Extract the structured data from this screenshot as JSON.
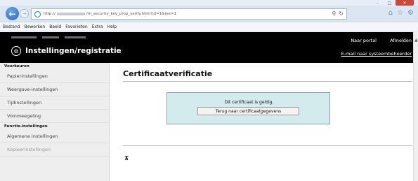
{
  "browser": {
    "address_prefix": "http://",
    "address_suffix": "/m_security_key_prop_verify.html?id=1&res=1",
    "icons": [
      "back-icon",
      "forward-icon",
      "search-icon",
      "refresh-icon",
      "home-icon",
      "star-icon",
      "gear-icon"
    ]
  },
  "menubar": {
    "items": [
      "Bestand",
      "Bewerken",
      "Beeld",
      "Favorieten",
      "Extra",
      "Help"
    ]
  },
  "header": {
    "title": "Instellingen/registratie",
    "portal_link": "Naar portal",
    "logout_link": "Afmelden",
    "mail_link": "E-mail naar systeembeheerder"
  },
  "sidebar": {
    "section1": "Voorkeuren",
    "items1": [
      "Papierinstellingen",
      "Weergave-instellingen",
      "Tijdinstellingen",
      "Voinmeegeling"
    ],
    "section2": "Functie-instellingen",
    "items2": [
      "Algemene instellingen",
      "Kopieerinstellingen"
    ]
  },
  "main": {
    "page_title": "Certificaatverificatie",
    "status_text": "Dit certificaat is geldig.",
    "back_button": "Terug naar certificaatgegevens"
  },
  "colors": {
    "header_bg": "#000000",
    "notice_bg": "#d4ebee",
    "sidebar_bg": "#eeeeee",
    "close_button": "#c9483a"
  }
}
